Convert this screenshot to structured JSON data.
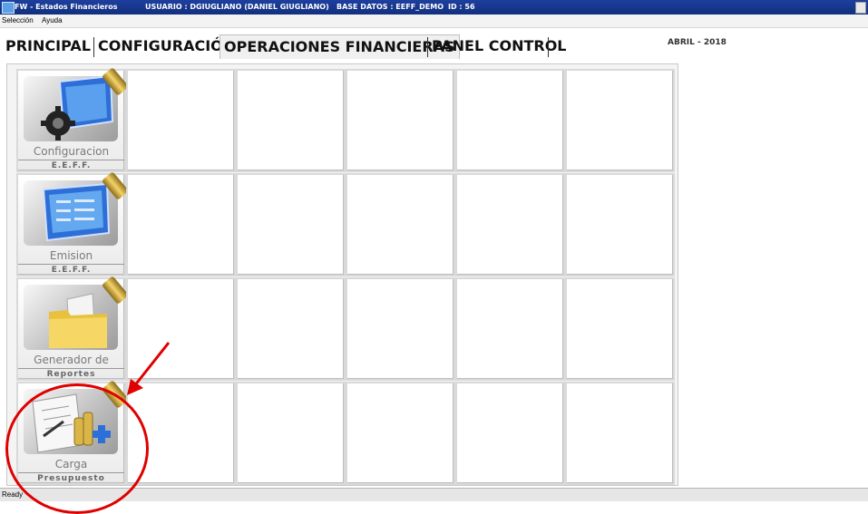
{
  "window": {
    "title": "FW - Estados Financieros",
    "usuario": "USUARIO : DGIUGLIANO (DANIEL GIUGLIANO)",
    "base_datos": "BASE DATOS : EEFF_DEMO",
    "id": "ID : 56"
  },
  "menu": {
    "items": [
      "Selección",
      "Ayuda"
    ]
  },
  "tabs": [
    {
      "label": "PRINCIPAL",
      "active": false
    },
    {
      "label": "CONFIGURACIÓN",
      "active": false
    },
    {
      "label": "OPERACIONES FINANCIERAS",
      "active": true
    },
    {
      "label": "PANEL CONTROL",
      "active": false
    }
  ],
  "date_label": "ABRIL - 2018",
  "tiles": [
    {
      "line1": "Configuracion",
      "line2": "E.E.F.F.",
      "icon": "gear-config-icon"
    },
    {
      "line1": "Emision",
      "line2": "E.E.F.F.",
      "icon": "document-screen-icon"
    },
    {
      "line1": "Generador de",
      "line2": "Reportes",
      "icon": "folder-icon"
    },
    {
      "line1": "Carga",
      "line2": "Presupuesto",
      "icon": "budget-coins-icon"
    }
  ],
  "status": {
    "text": "Ready"
  },
  "colors": {
    "titlebar": "#1d3f9e",
    "annotation": "#e00000",
    "accent_gold": "#d9b54a"
  }
}
